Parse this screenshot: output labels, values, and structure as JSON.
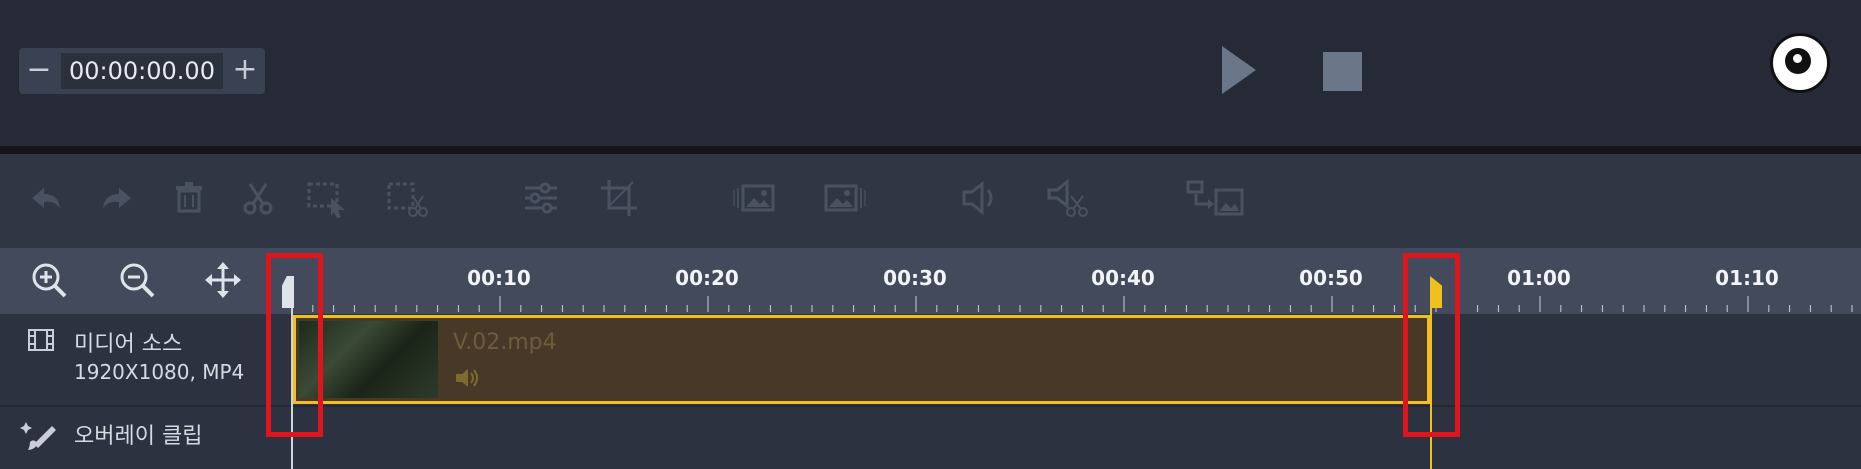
{
  "header": {
    "time_minus": "−",
    "timecode": "00:00:00.00",
    "time_plus": "+"
  },
  "toolbar": {
    "tools": [
      "undo-icon",
      "redo-icon",
      "delete-icon",
      "cut-icon",
      "select-region-icon",
      "delete-region-icon",
      "adjust-icon",
      "crop-icon",
      "fade-in-image-icon",
      "fade-out-image-icon",
      "volume-icon",
      "mute-cut-icon",
      "move-to-icon"
    ]
  },
  "timeline": {
    "ruler_labels": [
      "00:10",
      "00:20",
      "00:30",
      "00:40",
      "00:50",
      "01:00",
      "01:10"
    ],
    "tracks": {
      "media_label": "미디어 소스",
      "media_info": "1920X1080, MP4",
      "overlay_label": "오버레이 클립"
    },
    "clip": {
      "name": "V.02.mp4"
    }
  },
  "colors": {
    "accent": "#f2c01d",
    "highlight": "#e0141c",
    "clip_bg": "#473828"
  }
}
